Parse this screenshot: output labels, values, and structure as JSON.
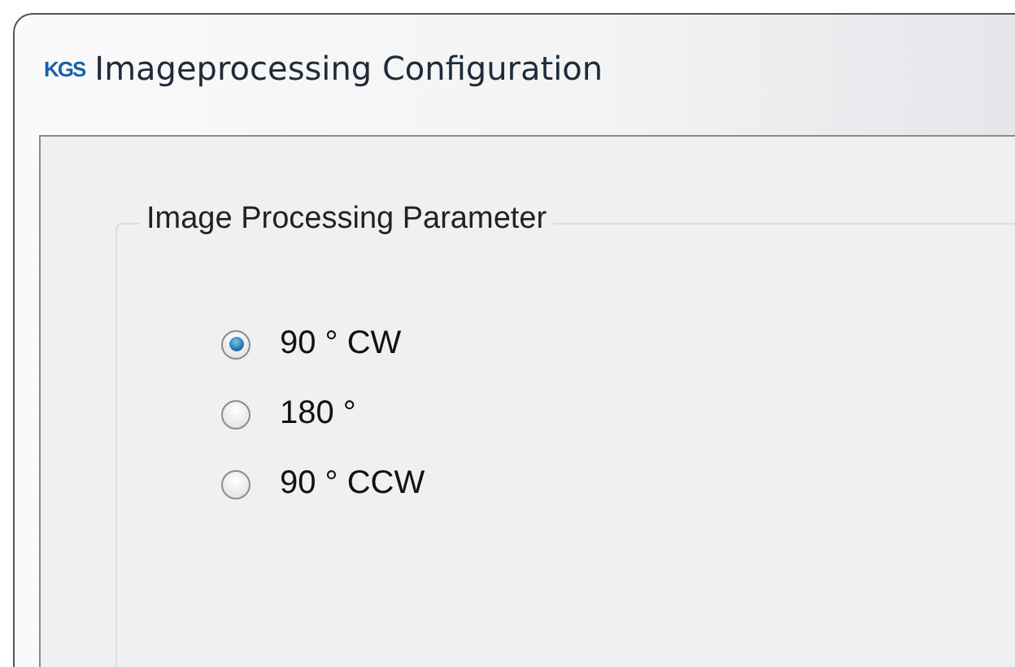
{
  "window": {
    "logo": "KGS",
    "title": "Imageprocessing Configuration"
  },
  "group": {
    "title": "Image Processing Parameter",
    "options": [
      {
        "label": "90 ° CW",
        "selected": true
      },
      {
        "label": "180 °",
        "selected": false
      },
      {
        "label": "90 ° CCW",
        "selected": false
      }
    ]
  }
}
